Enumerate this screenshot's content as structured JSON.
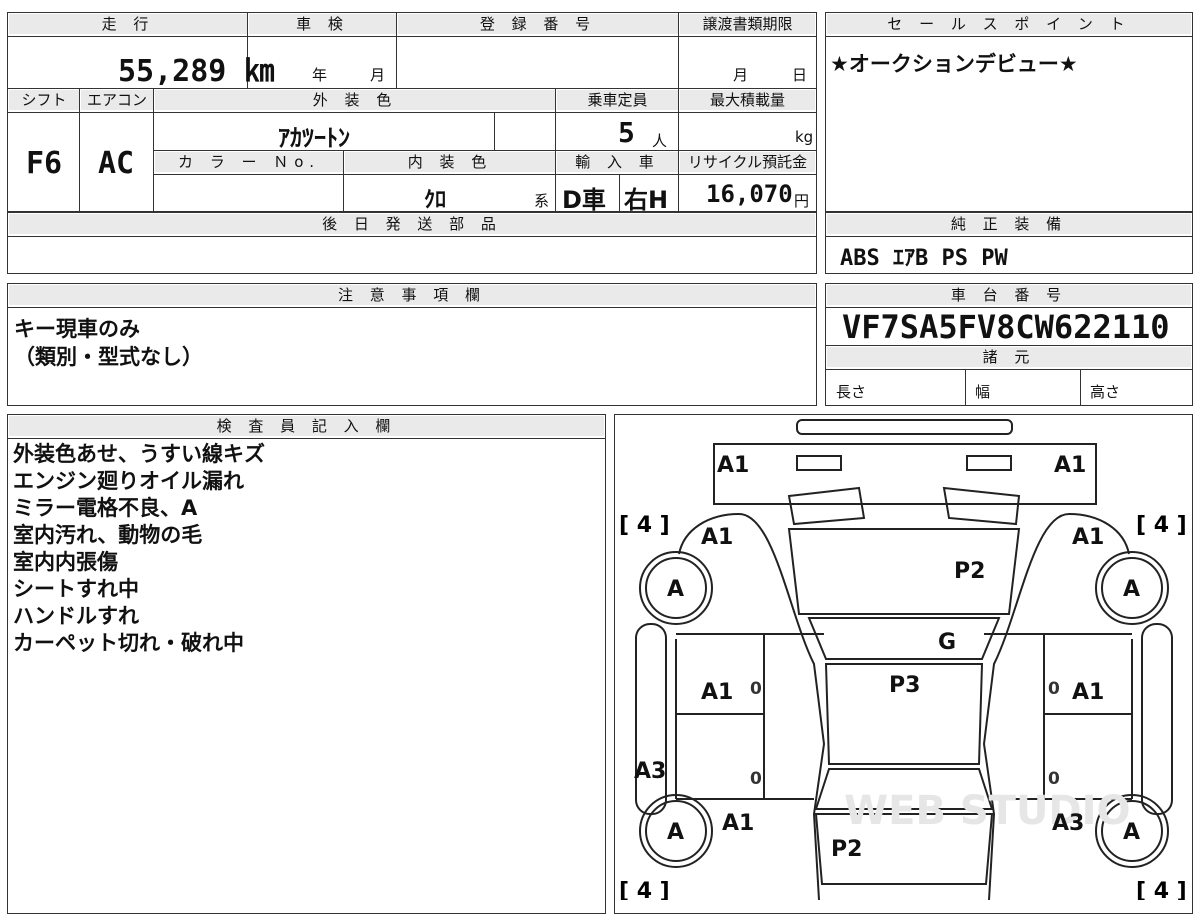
{
  "top": {
    "header_mileage": "走 行",
    "header_inspection": "車 検",
    "header_registration": "登 録 番 号",
    "header_transfer_deadline": "譲渡書類期限",
    "mileage": "55,289 ㎞",
    "inspection_year": "年",
    "inspection_month": "月",
    "transfer_month": "月",
    "transfer_day": "日"
  },
  "row2": {
    "header_shift": "シフト",
    "header_aircon": "エアコン",
    "header_exterior_color": "外 装 色",
    "header_capacity": "乗車定員",
    "header_max_load": "最大積載量",
    "shift": "F6",
    "aircon": "AC",
    "exterior_color": "ｱｶﾂｰﾄﾝ",
    "capacity": "5",
    "capacity_unit": "人",
    "load_unit": "kg",
    "header_color_no": "カ ラ ー Ｎo.",
    "header_interior_color": "内 装 色",
    "header_import": "輸 入 車",
    "header_recycle": "リサイクル預託金",
    "interior_color": "ｸﾛ",
    "interior_suffix": "系",
    "dealer": "D車",
    "handle": "右H",
    "recycle_fee": "16,070",
    "recycle_unit": "円"
  },
  "later_parts": {
    "header": "後 日 発 送 部 品"
  },
  "sales_point": {
    "header": "セ ー ル ス ポ イ ン ト",
    "text": "★オークションデビュー★"
  },
  "equipment": {
    "header": "純 正 装 備",
    "text": "ABS ｴｱB PS PW"
  },
  "caution": {
    "header": "注 意 事 項 欄",
    "line1": "キー現車のみ",
    "line2": "（類別・型式なし）"
  },
  "chassis": {
    "header": "車 台 番 号",
    "number": "VF7SA5FV8CW622110"
  },
  "specs": {
    "header": "諸 元",
    "length": "長さ",
    "width": "幅",
    "height": "高さ"
  },
  "inspector": {
    "header": "検 査 員 記 入 欄",
    "notes": [
      "外装色あせ、うすい線キズ",
      "エンジン廻りオイル漏れ",
      "ミラー電格不良、A",
      "室内汚れ、動物の毛",
      "室内内張傷",
      "シートすれ中",
      "ハンドルすれ",
      "カーペット切れ・破れ中"
    ]
  },
  "diagram": {
    "marks": {
      "front_left": "A1",
      "front_right": "A1",
      "left_fender": "A1",
      "right_fender": "A1",
      "hood": "P2",
      "windshield": "G",
      "roof": "P3",
      "left_front_door": "A1",
      "right_front_door": "A1",
      "left_rocker": "A3",
      "right_rear": "A3",
      "left_rear": "A1",
      "trunk": "P2",
      "wheel_fl": "A",
      "wheel_fr": "A",
      "wheel_rl": "A",
      "wheel_rr": "A",
      "door_zero_1": "0",
      "door_zero_2": "0",
      "door_zero_3": "0",
      "door_zero_4": "0"
    },
    "tire_tl": "[ 4 ]",
    "tire_tr": "[ 4 ]",
    "tire_bl": "[ 4 ]",
    "tire_br": "[ 4 ]",
    "watermark": "WEB STUDIO"
  }
}
